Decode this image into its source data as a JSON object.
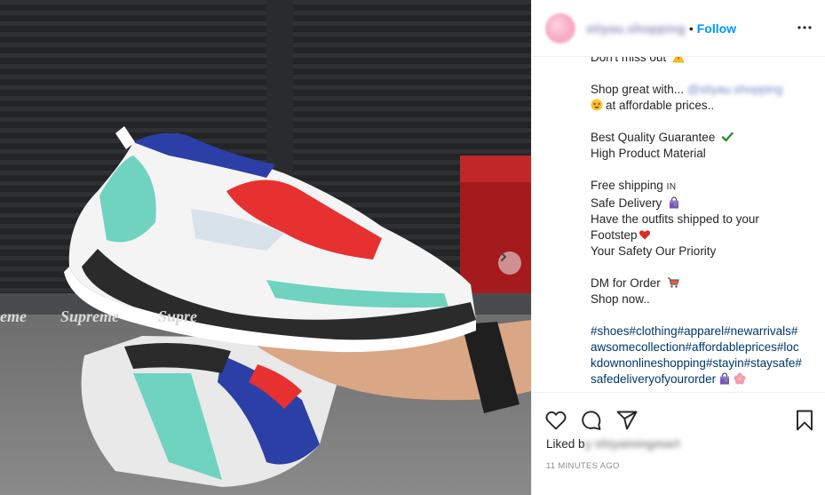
{
  "photo": {
    "wall_text_left": "eme",
    "wall_text_middle": "Supreme",
    "wall_text_right": "Supre",
    "next_icon": "chevron-right-icon"
  },
  "header": {
    "username": "stiyau.shopping",
    "separator": "•",
    "follow_label": "Follow",
    "more_icon": "more-horizontal-icon"
  },
  "caption": {
    "line_top": "Don't miss out",
    "line_shop_a": "Shop great with...",
    "line_shop_handle": "@stiyau.shopping",
    "line_shop_b": "at affordable prices..",
    "line_quality": "Best Quality Guarantee",
    "line_material": "High Product Material",
    "line_free": "Free shipping",
    "line_free_suffix": "IN",
    "line_safe": "Safe Delivery",
    "line_outfits": "Have the outfits shipped to your",
    "line_footstep": "Footstep",
    "line_priority": "Your Safety Our Priority",
    "line_dm": "DM for Order",
    "line_shopnow": "Shop now..",
    "hashtags": "#shoes#clothing#apparel#newarrivals#awsomecollection#affordableprices#lockdownonlineshopping#stayin#staysafe#safedeliveryofyourorder"
  },
  "actions": {
    "like_icon": "heart-icon",
    "comment_icon": "comment-icon",
    "share_icon": "share-icon",
    "save_icon": "bookmark-icon",
    "liked_prefix": "Liked b",
    "liked_name": "y shiyainingmart",
    "timestamp": "11 MINUTES AGO"
  },
  "colors": {
    "follow": "#0095f6",
    "hashtag": "#00376b",
    "text": "#262626",
    "muted": "#8e8e8e"
  }
}
